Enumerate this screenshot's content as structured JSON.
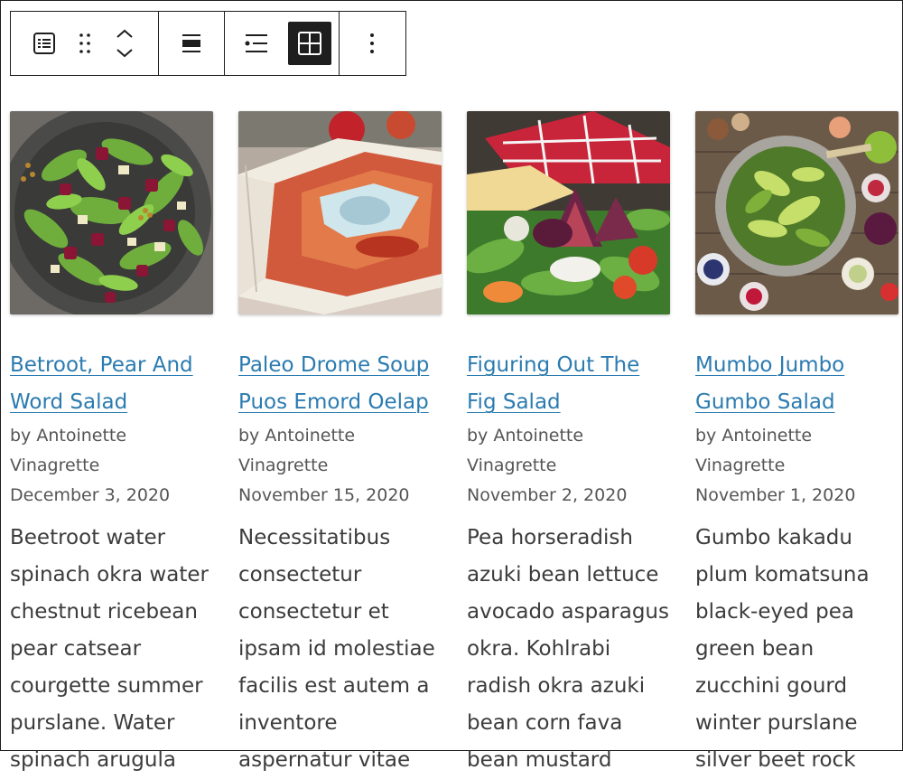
{
  "toolbar": {
    "buttons": [
      "block-type",
      "drag",
      "move-up-down",
      "align",
      "list-view",
      "grid-view",
      "options"
    ],
    "active": "grid-view"
  },
  "posts": [
    {
      "title": "Betroot, Pear And Word Salad",
      "author": "by Antoinette Vinagrette",
      "date": "December 3, 2020",
      "excerpt": "Beetroot water spinach okra water chestnut ricebean pear catsear courgette summer purslane. Water spinach arugula"
    },
    {
      "title": "Paleo Drome Soup Puos Emord Oelap",
      "author": "by Antoinette Vinagrette",
      "date": "November 15, 2020",
      "excerpt": "Necessitatibus consectetur consectetur et ipsam id molestiae facilis est autem a inventore aspernatur vitae"
    },
    {
      "title": "Figuring Out The Fig Salad",
      "author": "by Antoinette Vinagrette",
      "date": "November 2, 2020",
      "excerpt": "Pea horseradish azuki bean lettuce avocado asparagus okra. Kohlrabi radish okra azuki bean corn fava bean mustard"
    },
    {
      "title": "Mumbo Jumbo Gumbo Salad",
      "author": "by Antoinette Vinagrette",
      "date": "November 1, 2020",
      "excerpt": "Gumbo kakadu plum komatsuna black-eyed pea green bean zucchini gourd winter purslane silver beet rock"
    }
  ]
}
